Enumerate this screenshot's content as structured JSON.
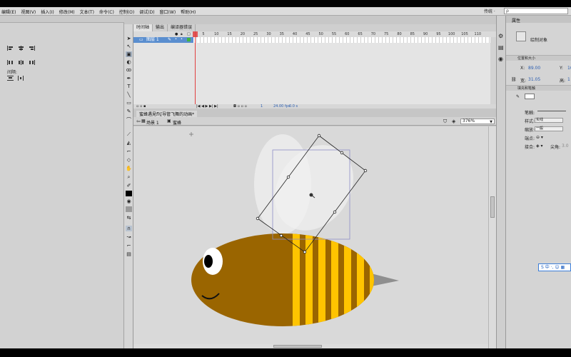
{
  "menubar": {
    "items": [
      "编辑(E)",
      "视图(V)",
      "插入(I)",
      "修改(M)",
      "文本(T)",
      "命令(C)",
      "控制(O)",
      "调试(D)",
      "窗口(W)",
      "帮助(H)"
    ],
    "workspace": "传统 ·",
    "search_icon": "ρ"
  },
  "left_panel": {
    "label": "间隔:"
  },
  "timeline": {
    "tabs": [
      "时间轴",
      "输出",
      "编译器错误"
    ],
    "layer_name": "图层 1",
    "ruler_ticks": [
      "5",
      "10",
      "15",
      "20",
      "25",
      "30",
      "35",
      "40",
      "45",
      "50",
      "55",
      "60",
      "65",
      "70",
      "75",
      "80",
      "85",
      "90",
      "95",
      "100",
      "105",
      "110"
    ],
    "frame_number": "1",
    "fps": "24.00 fps",
    "time": "0.0 s"
  },
  "document": {
    "tab_title": "蜜蜂遇見fl\\[导管飞舞的动画*",
    "scene": "场景 1",
    "symbol": "蜜蜂",
    "zoom": "376%"
  },
  "properties": {
    "tab_label": "属性",
    "object_type": "绘制对象",
    "section_position": "位置和大小",
    "x_label": "X:",
    "x_value": "89.00",
    "y_label": "Y:",
    "y_value": "10",
    "w_label": "宽:",
    "w_value": "31.05",
    "h_label": "高:",
    "h_value": "1",
    "section_fill": "填充和笔触",
    "stroke_label": "笔触:",
    "style_label": "样式:",
    "style_value": "实线",
    "scale_label": "缩放:",
    "scale_value": "一般",
    "cap_label": "端点:",
    "cap_value": "⊖ ▾",
    "join_label": "接合:",
    "join_value": "◈ ▾",
    "miter_label": "尖角:",
    "miter_value": "3.0"
  },
  "ime": {
    "text": "S 中 ·, ☺ ▦"
  },
  "colors": {
    "bee_body": "#9a6500",
    "bee_stripe": "#ffc400",
    "wing": "#ececec",
    "stinger": "#8f8f8f",
    "selection": "#8e8ec8",
    "layer_highlight": "#5a8ecf",
    "playhead": "#e04040"
  }
}
